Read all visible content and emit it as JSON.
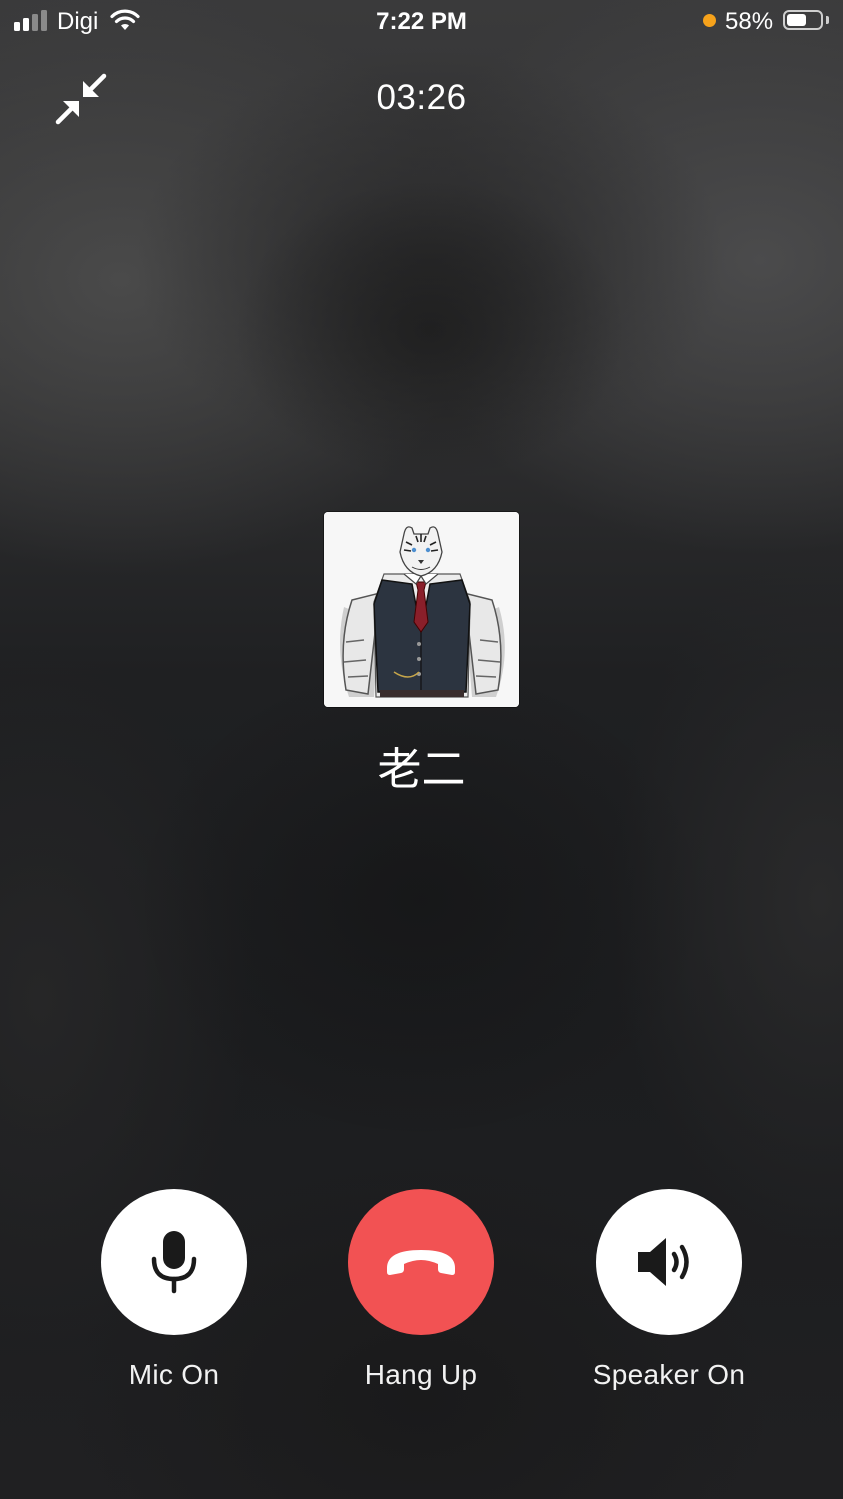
{
  "status_bar": {
    "carrier": "Digi",
    "time": "7:22 PM",
    "battery_percent_text": "58%",
    "battery_level": 0.58,
    "signal_bars_active": 2,
    "signal_bars_total": 4,
    "recording_indicator_color": "#f6a21b",
    "icons": [
      "signal-icon",
      "wifi-icon",
      "battery-icon"
    ]
  },
  "call": {
    "timer": "03:26",
    "contact_name": "老二",
    "minimize_icon": "minimize-arrows-icon"
  },
  "controls": [
    {
      "label": "Mic On",
      "icon": "microphone-icon",
      "color": "#ffffff"
    },
    {
      "label": "Hang Up",
      "icon": "phone-hangup-icon",
      "color": "#f25253"
    },
    {
      "label": "Speaker On",
      "icon": "speaker-icon",
      "color": "#ffffff"
    }
  ]
}
